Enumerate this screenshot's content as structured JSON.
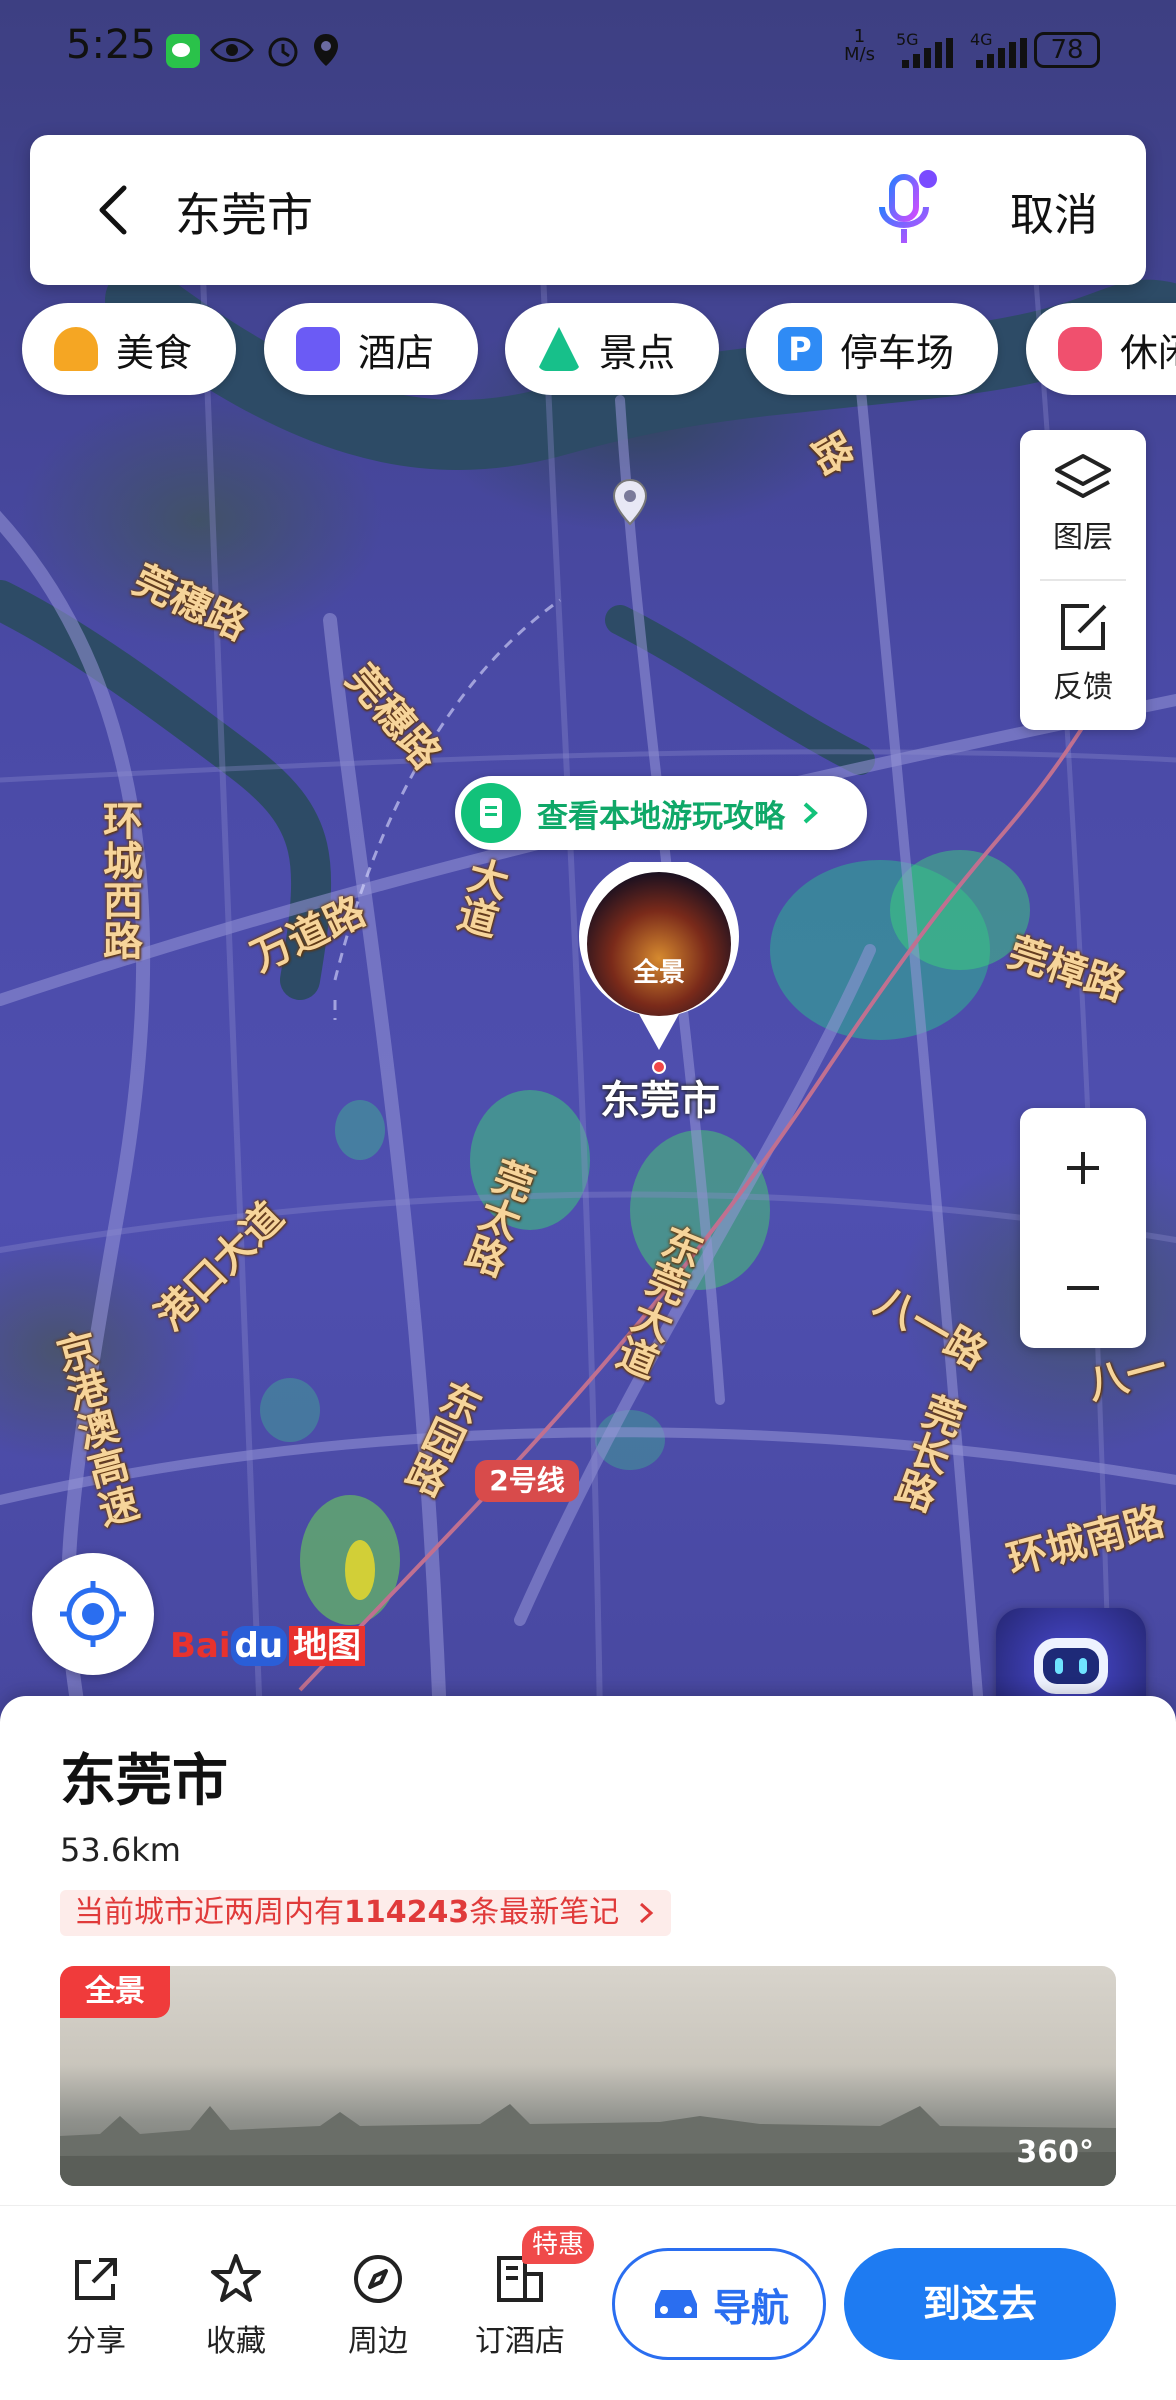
{
  "status_bar": {
    "time": "5:25",
    "net_speed_top": "1",
    "net_speed_unit": "M/s",
    "signal_1": "5G",
    "signal_2": "4G",
    "battery": "78"
  },
  "search": {
    "query": "东莞市",
    "cancel_label": "取消"
  },
  "categories": [
    {
      "label": "美食",
      "icon": "food-icon",
      "color": "#f5a623"
    },
    {
      "label": "酒店",
      "icon": "hotel-icon",
      "color": "#6b5bf5"
    },
    {
      "label": "景点",
      "icon": "scenic-icon",
      "color": "#17c08a"
    },
    {
      "label": "停车场",
      "icon": "parking-icon",
      "color": "#2f8bf5"
    },
    {
      "label": "休闲",
      "icon": "leisure-icon",
      "color": "#f0506e"
    }
  ],
  "map_tools": {
    "layers_label": "图层",
    "feedback_label": "反馈"
  },
  "map": {
    "guide_text": "查看本地游玩攻略",
    "pin_badge": "全景",
    "city_label": "东莞市",
    "metro_line": "2号线",
    "logo_text_1": "Bai",
    "logo_text_2": "du",
    "logo_text_3": "地图",
    "roads": {
      "r1": "莞穗路",
      "r2": "莞穗路",
      "r3": "环城西路",
      "r4": "万道路",
      "r5": "大道",
      "r6": "莞樟路",
      "r7": "港口大道",
      "r8": "莞太路",
      "r9": "东莞大道",
      "r10": "八一路",
      "r11": "莞长路",
      "r12": "京港澳高速",
      "r13": "东园路",
      "r14": "环城南路",
      "r15": "路",
      "r16": "八一"
    }
  },
  "place": {
    "name": "东莞市",
    "distance": "53.6km",
    "notes_prefix": "当前城市近两周内有",
    "notes_count": "114243",
    "notes_suffix": "条最新笔记",
    "pano_tag": "全景",
    "pano_360": "360°"
  },
  "actions": {
    "share": "分享",
    "favorite": "收藏",
    "nearby": "周边",
    "book_hotel": "订酒店",
    "hot_badge": "特惠",
    "navigate": "导航",
    "go_here": "到这去"
  },
  "colors": {
    "accent": "#1e7bf2",
    "guide_green": "#12c27a",
    "notes_red": "#e03a3a"
  }
}
